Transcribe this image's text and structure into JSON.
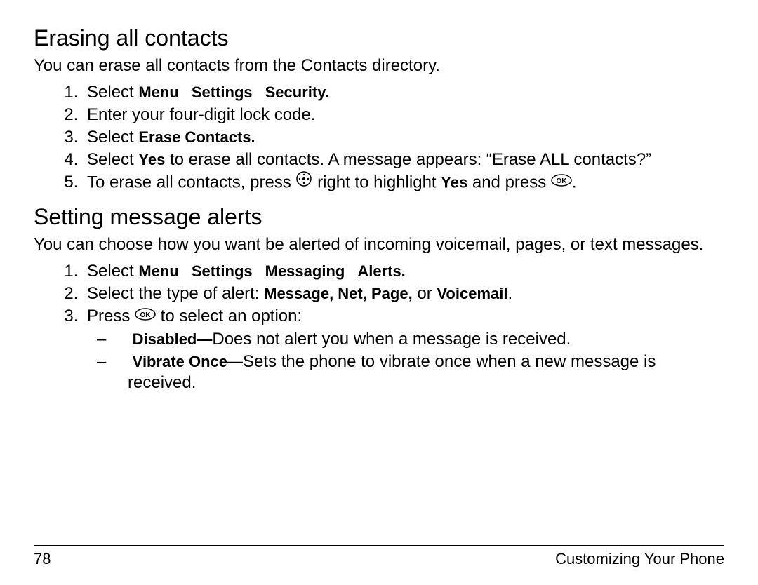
{
  "section1": {
    "heading": "Erasing all contacts",
    "intro": "You can erase all contacts from the Contacts directory.",
    "steps": {
      "s1": {
        "prefix": "Select ",
        "m1": "Menu",
        "m2": "Settings",
        "m3": "Security."
      },
      "s2": "Enter your four-digit lock code.",
      "s3": {
        "prefix": "Select ",
        "bold": "Erase Contacts."
      },
      "s4": {
        "prefix": "Select ",
        "bold": "Yes",
        "suffix": " to erase all contacts. A message appears: “Erase ALL contacts?”"
      },
      "s5": {
        "p1": "To erase all contacts, press ",
        "p2": " right to highlight ",
        "bold": "Yes",
        "p3": " and press ",
        "p4": "."
      }
    }
  },
  "section2": {
    "heading": "Setting message alerts",
    "intro": "You can choose how you want be alerted of incoming voicemail, pages, or text messages.",
    "steps": {
      "s1": {
        "prefix": "Select ",
        "m1": "Menu",
        "m2": "Settings",
        "m3": "Messaging",
        "m4": "Alerts."
      },
      "s2": {
        "prefix": "Select the type of alert: ",
        "bold": "Message, Net, Page,",
        "mid": " or ",
        "bold2": "Voicemail",
        "suffix": "."
      },
      "s3": {
        "p1": "Press ",
        "p2": " to select an option:"
      },
      "sub": {
        "a": {
          "bold": "Disabled—",
          "text": "Does not alert you when a message is received."
        },
        "b": {
          "bold": "Vibrate Once—",
          "text": "Sets the phone to vibrate once when a new message is received."
        }
      }
    }
  },
  "footer": {
    "page": "78",
    "title": "Customizing Your Phone"
  }
}
